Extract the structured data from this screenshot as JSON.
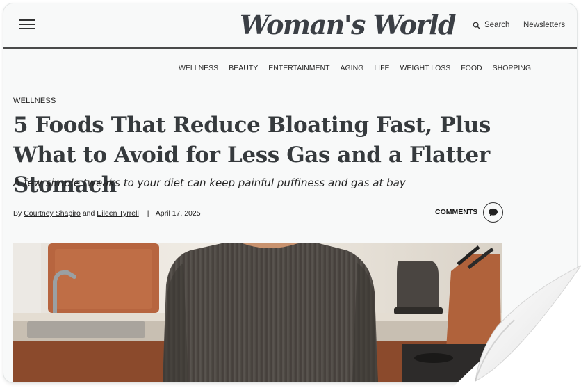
{
  "header": {
    "logo_text": "Woman's World",
    "search_label": "Search",
    "newsletters_label": "Newsletters"
  },
  "nav": {
    "items": [
      "WELLNESS",
      "BEAUTY",
      "ENTERTAINMENT",
      "AGING",
      "LIFE",
      "WEIGHT LOSS",
      "FOOD",
      "SHOPPING"
    ]
  },
  "article": {
    "category": "WELLNESS",
    "headline": "5 Foods That Reduce Bloating Fast, Plus What to Avoid for Less Gas and a Flatter Stomach",
    "dek": "A few simple tweaks to your diet can keep painful puffiness and gas at bay",
    "byline": {
      "by": "By",
      "author1": "Courtney Shapiro",
      "and": "and",
      "author2": "Eileen Tyrrell",
      "separator": "|",
      "date": "April 17, 2025"
    },
    "comments_label": "COMMENTS"
  },
  "icons": {
    "menu": "hamburger-menu-icon",
    "search": "magnifier-icon",
    "comments": "speech-bubble-icon"
  },
  "colors": {
    "text": "#363a3d",
    "rule": "#4a4a4a",
    "background": "#f8f9f9"
  }
}
